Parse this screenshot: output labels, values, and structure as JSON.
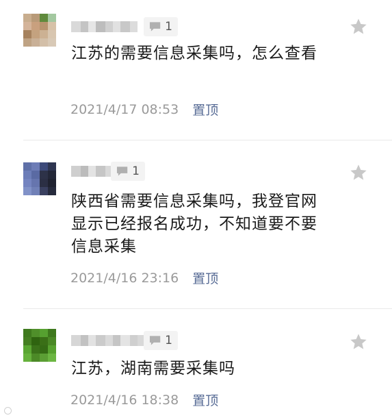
{
  "comments": [
    {
      "reply_count": "1",
      "text": "江苏的需要信息采集吗，怎么查看",
      "time": "2021/4/17 08:53",
      "pin_label": "置顶",
      "avatar_colors": [
        "#c8ad8e",
        "#b89a78",
        "#5f8a3c",
        "#a3c8a0",
        "#d4b49a",
        "#c9a07e",
        "#b8946f",
        "#d7c2a8",
        "#a6825e",
        "#c4a27f",
        "#ccb193",
        "#d8c6b0",
        "#bfa384",
        "#c9b097",
        "#d3bfa8",
        "#d8c9b6"
      ],
      "name_blur": [
        "#d9d9d9",
        "#c4c4c4",
        "#e6e6e6",
        "#bdbdbd",
        "#d0d0d0",
        "#e1e1e1",
        "#c8c8c8",
        "#dcdcdc"
      ]
    },
    {
      "reply_count": "1",
      "text": "陕西省需要信息采集吗，我登官网显示已经报名成功，不知道要不要信息采集",
      "time": "2021/4/16 23:16",
      "pin_label": "置顶",
      "avatar_colors": [
        "#5f70a8",
        "#6d7cb6",
        "#3d4a7a",
        "#2e3550",
        "#6c7db8",
        "#5a6aa3",
        "#2d3248",
        "#232738",
        "#7484c0",
        "#6675ae",
        "#2b2f44",
        "#1f2230",
        "#8192c8",
        "#7080b7",
        "#3a4060",
        "#262a3c"
      ],
      "name_blur": [
        "#cfcfcf",
        "#bcbcbc",
        "#e3e3e3",
        "#c6c6c6",
        "#d9d9d9"
      ]
    },
    {
      "reply_count": "1",
      "text": "江苏，湖南需要采集吗",
      "time": "2021/4/16 18:38",
      "pin_label": "置顶",
      "avatar_colors": [
        "#3f7a1e",
        "#4f8f2a",
        "#56a030",
        "#3e781d",
        "#457f22",
        "#2f6410",
        "#3a6f17",
        "#4a8825",
        "#5aa632",
        "#3b721a",
        "#356b15",
        "#57a12f",
        "#66b23c",
        "#4c8a27",
        "#5b9e34",
        "#6cb642"
      ],
      "name_blur": [
        "#d6d6d6",
        "#c2c2c2",
        "#e2e2e2",
        "#cbcbcb",
        "#dadada",
        "#c5c5c5",
        "#e4e4e4",
        "#cfcfcf",
        "#d8d8d8"
      ]
    }
  ],
  "icons": {
    "reply": "comment-bubble-icon",
    "star": "star-icon"
  },
  "colors": {
    "pin_link": "#576b95",
    "time_text": "#9a9a9a",
    "badge_bg": "#f3f3f3",
    "star_fill": "#c8c8c8"
  }
}
